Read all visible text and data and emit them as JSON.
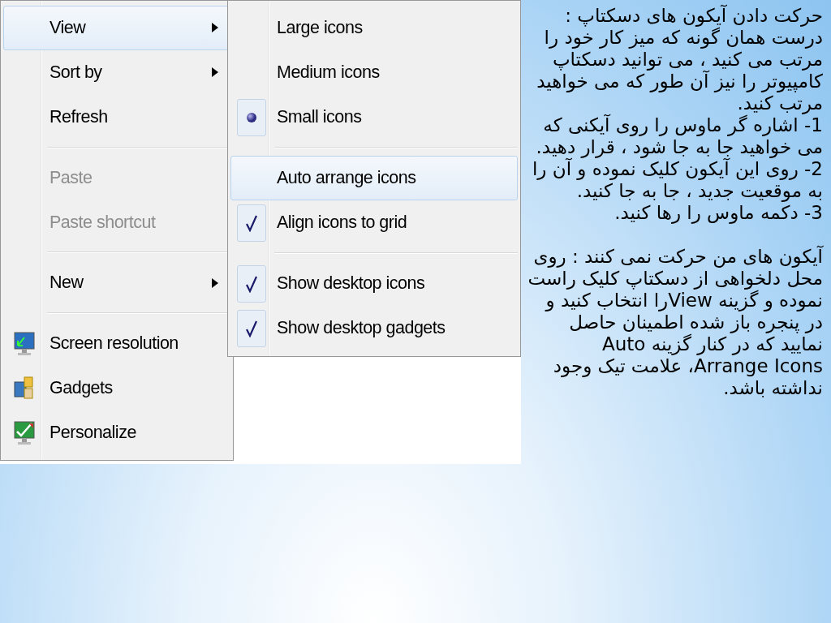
{
  "context_menu": {
    "items": [
      {
        "kind": "item",
        "label": "View",
        "disabled": false,
        "selected": true,
        "has_submenu": true,
        "has_icon": false
      },
      {
        "kind": "item",
        "label": "Sort by",
        "disabled": false,
        "selected": false,
        "has_submenu": true,
        "has_icon": false
      },
      {
        "kind": "item",
        "label": "Refresh",
        "disabled": false,
        "selected": false,
        "has_submenu": false,
        "has_icon": false
      },
      {
        "kind": "separator"
      },
      {
        "kind": "item",
        "label": "Paste",
        "disabled": true,
        "selected": false,
        "has_submenu": false,
        "has_icon": false
      },
      {
        "kind": "item",
        "label": "Paste shortcut",
        "disabled": true,
        "selected": false,
        "has_submenu": false,
        "has_icon": false
      },
      {
        "kind": "separator"
      },
      {
        "kind": "item",
        "label": "New",
        "disabled": false,
        "selected": false,
        "has_submenu": true,
        "has_icon": false
      },
      {
        "kind": "separator"
      },
      {
        "kind": "item",
        "label": "Screen resolution",
        "disabled": false,
        "selected": false,
        "has_submenu": false,
        "has_icon": true
      },
      {
        "kind": "item",
        "label": "Gadgets",
        "disabled": false,
        "selected": false,
        "has_submenu": false,
        "has_icon": true
      },
      {
        "kind": "item",
        "label": "Personalize",
        "disabled": false,
        "selected": false,
        "has_submenu": false,
        "has_icon": true
      }
    ]
  },
  "view_submenu": {
    "items": [
      {
        "kind": "radio",
        "label": "Large icons",
        "checked": false,
        "selected": false
      },
      {
        "kind": "radio",
        "label": "Medium icons",
        "checked": false,
        "selected": false
      },
      {
        "kind": "radio",
        "label": "Small icons",
        "checked": true,
        "selected": false
      },
      {
        "kind": "separator"
      },
      {
        "kind": "check",
        "label": "Auto arrange icons",
        "checked": false,
        "selected": true
      },
      {
        "kind": "check",
        "label": "Align icons to grid",
        "checked": true,
        "selected": false
      },
      {
        "kind": "separator"
      },
      {
        "kind": "check",
        "label": "Show desktop icons",
        "checked": true,
        "selected": false
      },
      {
        "kind": "check",
        "label": "Show desktop gadgets",
        "checked": true,
        "selected": false
      }
    ]
  },
  "text": {
    "paragraphs": [
      "حرکت دادن آیکون های دسکتاپ : درست همان گونه که میز کار خود را مرتب می کنید ، می توانید دسکتاپ کامپیوتر را نیز آن طور که می خواهید مرتب کنید.",
      "1- اشاره گر ماوس را روی آیکنی که می خواهید جا به جا شود ، قرار دهید.",
      "2- روی این آیکون کلیک نموده و آن را به موقعیت جدید ، جا به جا کنید.",
      "3- دکمه ماوس را رها کنید.",
      "آیکون های من حرکت نمی کنند : روی محل دلخواهی از دسکتاپ کلیک راست نموده و گزینه  Viewرا انتخاب کنید و در پنجره باز شده اطمینان حاصل نمایید که در کنار گزینه  Auto Arrange Icons، علامت تیک وجود نداشته باشد."
    ]
  }
}
